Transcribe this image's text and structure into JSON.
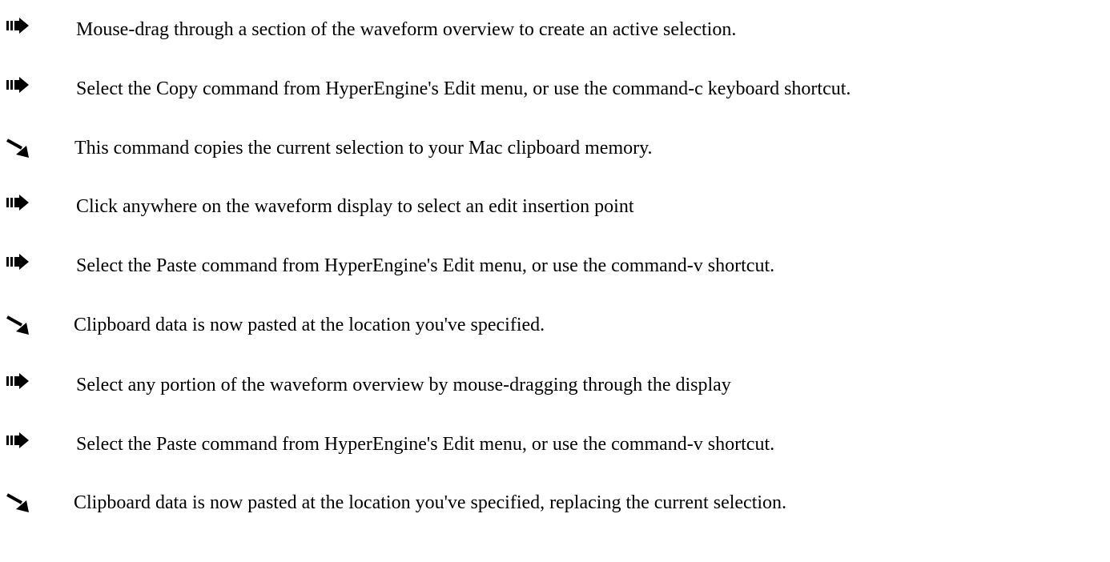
{
  "items": [
    {
      "type": "step",
      "icon": "step-arrow-icon",
      "text": "Mouse-drag through a section of the waveform overview to create an active selection."
    },
    {
      "type": "step",
      "icon": "step-arrow-icon",
      "text": "Select the Copy command from HyperEngine's Edit menu, or use the command-c keyboard shortcut."
    },
    {
      "type": "result",
      "icon": "result-arrow-icon",
      "text": "This command copies the current selection to your Mac clipboard memory."
    },
    {
      "type": "step",
      "icon": "step-arrow-icon",
      "text": "Click anywhere on the waveform display to select an edit insertion point"
    },
    {
      "type": "step",
      "icon": "step-arrow-icon",
      "text": "Select the Paste command from HyperEngine's Edit menu, or use the command-v shortcut."
    },
    {
      "type": "result",
      "icon": "result-arrow-icon",
      "text": "Clipboard data is now pasted at the location you've specified."
    },
    {
      "type": "step",
      "icon": "step-arrow-icon",
      "text": "Select any portion of the waveform overview by mouse-dragging through the display"
    },
    {
      "type": "step",
      "icon": "step-arrow-icon",
      "text": "Select the Paste command from HyperEngine's Edit menu, or use the command-v shortcut."
    },
    {
      "type": "result",
      "icon": "result-arrow-icon",
      "text": "Clipboard data is now pasted at the location you've specified, replacing the current selection."
    }
  ]
}
